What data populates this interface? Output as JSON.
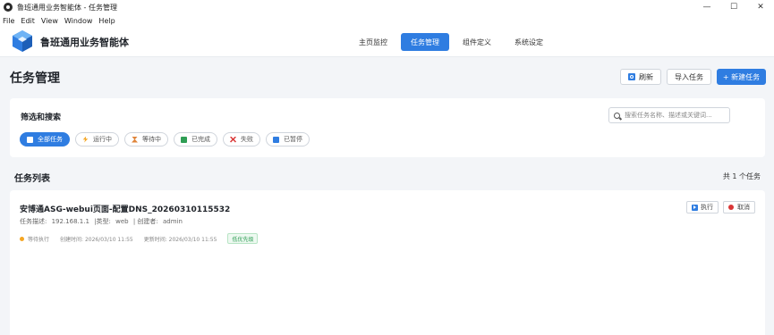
{
  "window": {
    "title": "鲁班通用业务智能体 - 任务管理",
    "controls": [
      "—",
      "☐",
      "✕"
    ]
  },
  "menu": [
    "File",
    "Edit",
    "View",
    "Window",
    "Help"
  ],
  "header": {
    "brand": "鲁班通用业务智能体",
    "nav": [
      {
        "label": "主页监控",
        "active": false
      },
      {
        "label": "任务管理",
        "active": true
      },
      {
        "label": "组件定义",
        "active": false
      },
      {
        "label": "系统设定",
        "active": false
      }
    ]
  },
  "page": {
    "title": "任务管理",
    "refresh_label": "刷新",
    "import_label": "导入任务",
    "new_label": "+ 新建任务"
  },
  "filter": {
    "title": "筛选和搜索",
    "search_placeholder": "搜索任务名称、描述或关键词...",
    "chips": [
      {
        "label": "全部任务",
        "icon": "grid-icon",
        "active": true
      },
      {
        "label": "运行中",
        "icon": "lightning-icon",
        "active": false
      },
      {
        "label": "等待中",
        "icon": "hourglass-icon",
        "active": false
      },
      {
        "label": "已完成",
        "icon": "check-icon",
        "active": false
      },
      {
        "label": "失败",
        "icon": "x-icon",
        "active": false
      },
      {
        "label": "已暂停",
        "icon": "pause-icon",
        "active": false
      }
    ]
  },
  "list": {
    "title": "任务列表",
    "count": "共 1 个任务",
    "tasks": [
      {
        "title": "安博通ASG-webui页面-配置DNS_20260310115532",
        "desc_label": "任务描述:",
        "desc": "192.168.1.1",
        "type_label": "|类型:",
        "type": "web",
        "creator_label": "| 创建者:",
        "creator": "admin",
        "status": "等待执行",
        "created": "创建时间: 2026/03/10 11:55",
        "updated": "更新时间: 2026/03/10 11:55",
        "priority": "低优先级",
        "run_label": "执行",
        "cancel_label": "取消"
      }
    ]
  },
  "colors": {
    "accent": "#2f7de1",
    "waiting": "#f5a623",
    "danger": "#d93636",
    "success": "#2f9e55"
  }
}
